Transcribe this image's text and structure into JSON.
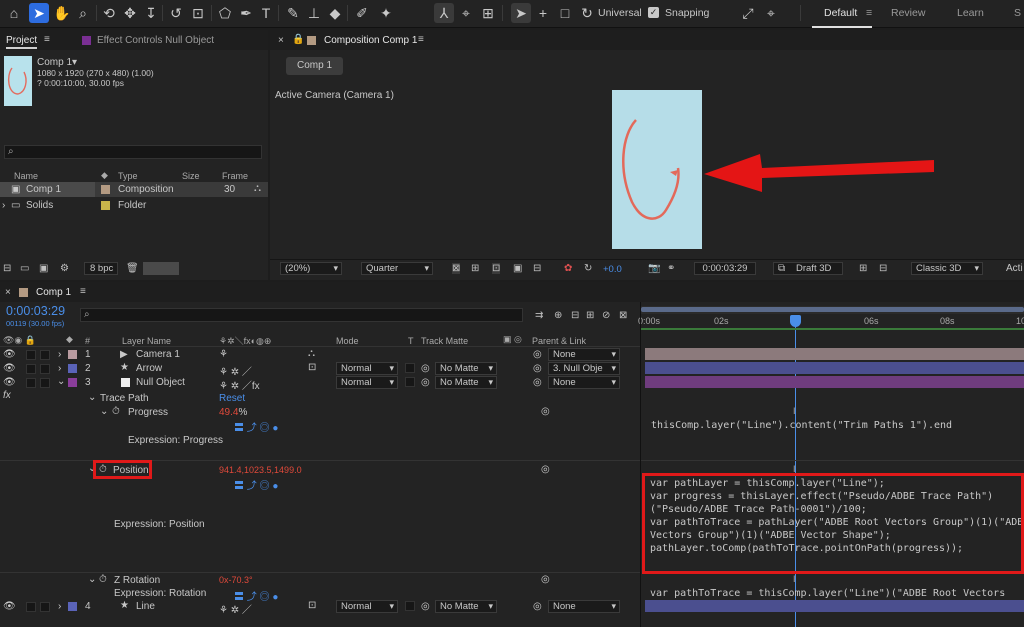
{
  "toolbar": {
    "universal_label": "Universal",
    "snapping_label": "Snapping",
    "workspaces": [
      "Default",
      "Review",
      "Learn",
      "S"
    ]
  },
  "project": {
    "tab_label": "Project",
    "effect_controls_label": "Effect Controls Null Object",
    "comp_name": "Comp 1",
    "comp_info_line1": "1080 x 1920 (270 x 480) (1.00)",
    "comp_info_line2": "? 0:00:10:00, 30.00 fps",
    "search_placeholder": "",
    "columns": [
      "Name",
      "Type",
      "Size",
      "Frame Ra..."
    ],
    "items": [
      {
        "name": "Comp 1",
        "type": "Composition",
        "size": "",
        "fps": "30"
      },
      {
        "name": "Solids",
        "type": "Folder",
        "size": "",
        "fps": ""
      }
    ],
    "bpc": "8 bpc"
  },
  "composition": {
    "tab_label": "Composition Comp 1",
    "subtab": "Comp 1",
    "camera_label": "Active Camera (Camera 1)",
    "zoom": "(20%)",
    "resolution": "Quarter",
    "exposure": "+0.0",
    "timecode": "0:00:03:29",
    "draft": "Draft 3D",
    "renderer": "Classic 3D",
    "view": "Acti"
  },
  "timeline": {
    "tab_label": "Comp 1",
    "timecode": "0:00:03:29",
    "frame_info": "00119 (30.00 fps)",
    "columns": {
      "layer_name": "Layer Name",
      "mode": "Mode",
      "t": "T",
      "track_matte": "Track Matte",
      "parent": "Parent & Link"
    },
    "ruler": [
      "0:00s",
      "02s",
      "06s",
      "08s",
      "10"
    ],
    "layers": [
      {
        "num": "1",
        "name": "Camera 1",
        "mode": "",
        "matte": "",
        "parent": "None",
        "color": "#b99ba0"
      },
      {
        "num": "2",
        "name": "Arrow",
        "mode": "Normal",
        "matte": "No Matte",
        "parent": "3. Null Obje",
        "color": "#5a63b8"
      },
      {
        "num": "3",
        "name": "Null Object",
        "mode": "Normal",
        "matte": "No Matte",
        "parent": "None",
        "color": "#8a3d9a"
      },
      {
        "num": "4",
        "name": "Line",
        "mode": "Normal",
        "matte": "No Matte",
        "parent": "None",
        "color": "#5a63b8"
      }
    ],
    "effect_name": "Trace Path",
    "reset_label": "Reset",
    "progress_label": "Progress",
    "progress_value": "49.4",
    "progress_unit": "%",
    "expr_progress_label": "Expression: Progress",
    "position_label": "Position",
    "position_value": "941.4,1023.5,1499.0",
    "expr_position_label": "Expression: Position",
    "zrotation_label": "Z Rotation",
    "zrotation_value": "0x-70.3°",
    "expr_rotation_label": "Expression: Rotation",
    "expr_progress_code": "thisComp.layer(\"Line\").content(\"Trim Paths 1\").end",
    "expr_position_code": [
      "var pathLayer = thisComp.layer(\"Line\");",
      "var progress = thisLayer.effect(\"Pseudo/ADBE Trace Path\")",
      "(\"Pseudo/ADBE Trace Path-0001\")/100;",
      "var pathToTrace = pathLayer(\"ADBE Root Vectors Group\")(1)(\"ADBE",
      "Vectors Group\")(1)(\"ADBE Vector Shape\");",
      "pathLayer.toComp(pathToTrace.pointOnPath(progress));"
    ],
    "expr_rotation_code": "var pathToTrace = thisComp.layer(\"Line\")(\"ADBE Root Vectors"
  }
}
